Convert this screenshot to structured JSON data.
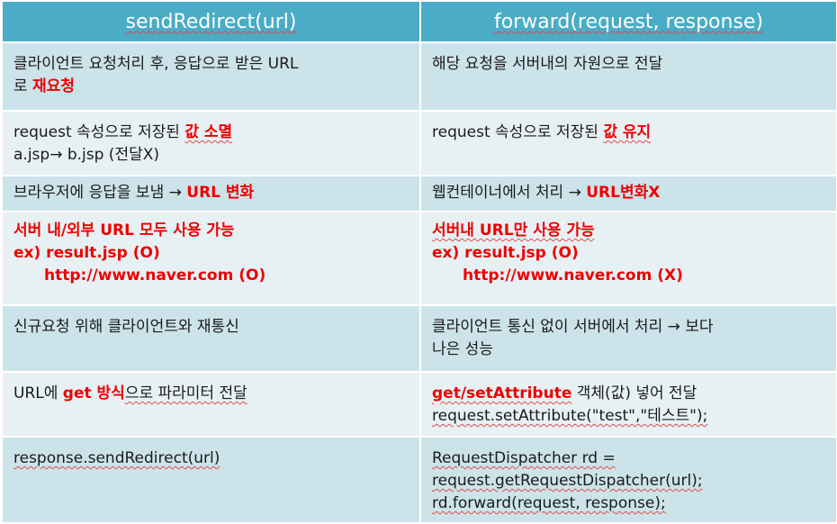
{
  "header": {
    "col1": "sendRedirect(url)",
    "col2": "forward(request, response)"
  },
  "rows": [
    {
      "left": {
        "l1": "클라이언트 요청처리 후, 응답으로 받은 URL",
        "l2a": "로 ",
        "l2b": "재요청"
      },
      "right": {
        "l1": "해당 요청을 서버내의 자원으로 전달"
      }
    },
    {
      "left": {
        "l1a": "request 속성으로 저장된 ",
        "l1b": "값 소멸",
        "l2": "a.jsp→ b.jsp (전달X)"
      },
      "right": {
        "l1a": "request 속성으로 저장된 ",
        "l1b": "값 유지"
      }
    },
    {
      "left": {
        "l1a": "브라우저에 응답을 보냄 → ",
        "l1b": "URL 변화"
      },
      "right": {
        "l1a": "웹컨테이너에서 처리 → ",
        "l1b": "URL변화X"
      }
    },
    {
      "left": {
        "l1": "서버 내/외부 URL 모두 사용 가능",
        "l2": "ex) result.jsp (O)",
        "l3": "http://www.naver.com (O)"
      },
      "right": {
        "l1": "서버내 URL만 사용 가능",
        "l2": "ex) result.jsp (O)",
        "l3": "http://www.naver.com (X)"
      }
    },
    {
      "left": {
        "l1": "신규요청 위해 클라이언트와 재통신"
      },
      "right": {
        "l1": "클라이언트 통신 없이 서버에서 처리 → 보다",
        "l2": "나은 성능"
      }
    },
    {
      "left": {
        "l1a": "URL에 ",
        "l1b": "get 방식",
        "l1c": "으로 파라미터 전달"
      },
      "right": {
        "l1a": "get/setAttribute",
        "l1b": " 객체(값) 넣어 전달",
        "l2": "request.setAttribute(\"test\",\"테스트\");"
      }
    },
    {
      "left": {
        "l1": "response.sendRedirect(url)"
      },
      "right": {
        "l1": "RequestDispatcher rd =",
        "l2": "request.getRequestDispatcher(url);",
        "l3": "rd.forward(request, response);"
      }
    }
  ],
  "colors": {
    "header_bg": "#4aacc5",
    "row_odd_bg": "#cce3ea",
    "row_even_bg": "#e7f1f4",
    "highlight": "#ee0000"
  }
}
